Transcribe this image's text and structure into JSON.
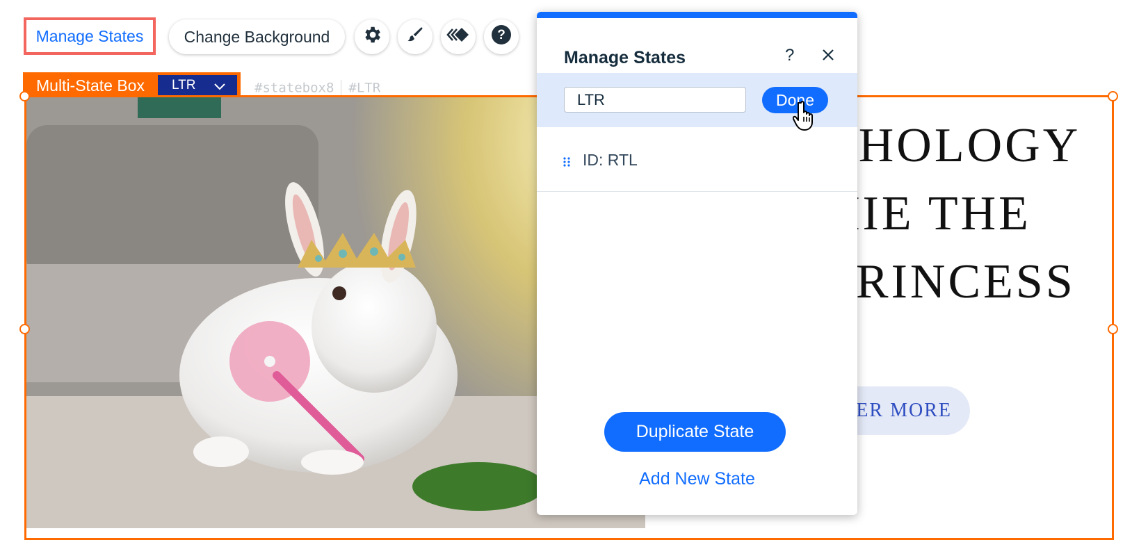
{
  "toolbar": {
    "manage_states_label": "Manage States",
    "change_background_label": "Change Background",
    "icons": [
      "gear-icon",
      "brush-icon",
      "animation-icon",
      "help-icon"
    ]
  },
  "state_box": {
    "tag_label": "Multi-State Box",
    "selected_state": "LTR",
    "element_id": "#statebox8",
    "state_id": "#LTR"
  },
  "site": {
    "heading_lines": [
      "THOLOGY",
      "HIE THE",
      "PRINCESS"
    ],
    "button_label": "VER MORE"
  },
  "panel": {
    "title": "Manage States",
    "help_label": "?",
    "editing_state_value": "LTR",
    "done_label": "Done",
    "states": [
      {
        "label": "ID: RTL"
      }
    ],
    "duplicate_label": "Duplicate State",
    "add_label": "Add New State"
  },
  "colors": {
    "accent": "#116dff",
    "selection": "#ff6a00",
    "selected_state_bg": "#162d8f",
    "highlight": "#f2665f"
  }
}
